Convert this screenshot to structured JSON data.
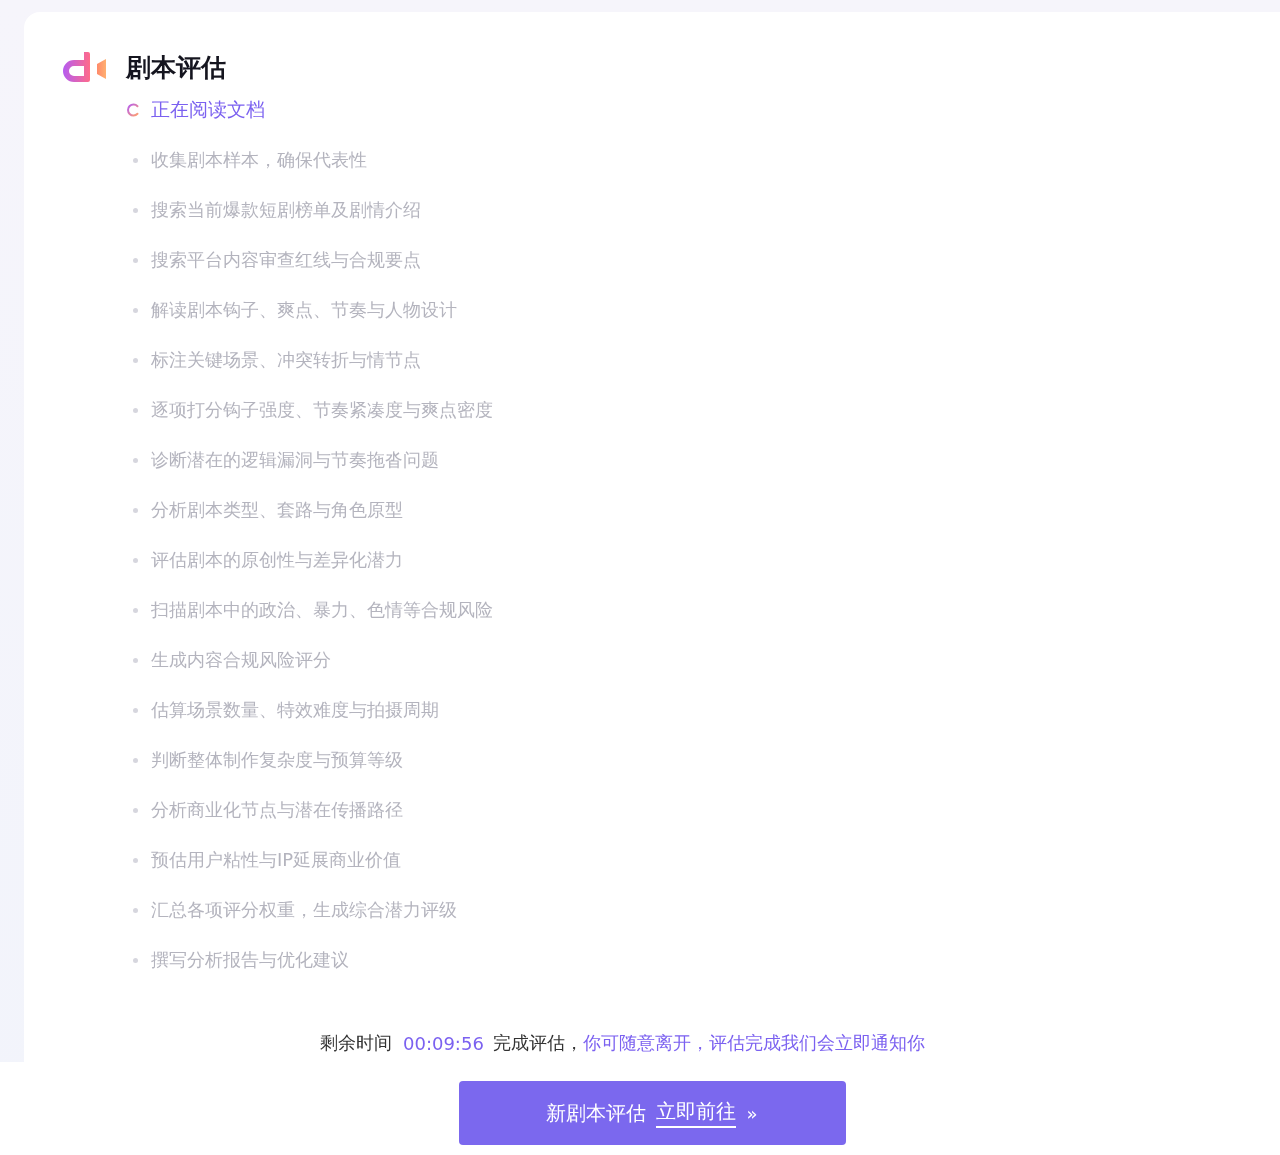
{
  "header": {
    "title": "剧本评估"
  },
  "steps": [
    {
      "label": "正在阅读文档",
      "kind": "active"
    },
    {
      "label": "收集剧本样本，确保代表性",
      "kind": "pending"
    },
    {
      "label": "搜索当前爆款短剧榜单及剧情介绍",
      "kind": "pending"
    },
    {
      "label": "搜索平台内容审查红线与合规要点",
      "kind": "pending"
    },
    {
      "label": "解读剧本钩子、爽点、节奏与人物设计",
      "kind": "pending"
    },
    {
      "label": "标注关键场景、冲突转折与情节点",
      "kind": "pending"
    },
    {
      "label": "逐项打分钩子强度、节奏紧凑度与爽点密度",
      "kind": "pending"
    },
    {
      "label": "诊断潜在的逻辑漏洞与节奏拖沓问题",
      "kind": "pending"
    },
    {
      "label": "分析剧本类型、套路与角色原型",
      "kind": "pending"
    },
    {
      "label": "评估剧本的原创性与差异化潜力",
      "kind": "pending"
    },
    {
      "label": "扫描剧本中的政治、暴力、色情等合规风险",
      "kind": "pending"
    },
    {
      "label": "生成内容合规风险评分",
      "kind": "pending"
    },
    {
      "label": "估算场景数量、特效难度与拍摄周期",
      "kind": "pending"
    },
    {
      "label": "判断整体制作复杂度与预算等级",
      "kind": "pending"
    },
    {
      "label": "分析商业化节点与潜在传播路径",
      "kind": "pending"
    },
    {
      "label": "预估用户粘性与IP延展商业价值",
      "kind": "pending"
    },
    {
      "label": "汇总各项评分权重，生成综合潜力评级",
      "kind": "pending"
    },
    {
      "label": "撰写分析报告与优化建议",
      "kind": "pending"
    }
  ],
  "notice": {
    "label": "剩余时间",
    "time": "00:09:56",
    "suffix": "完成评估，",
    "note": "你可随意离开，评估完成我们会立即通知你"
  },
  "button": {
    "text": "新剧本评估",
    "link": "立即前往",
    "chevron": "»"
  }
}
